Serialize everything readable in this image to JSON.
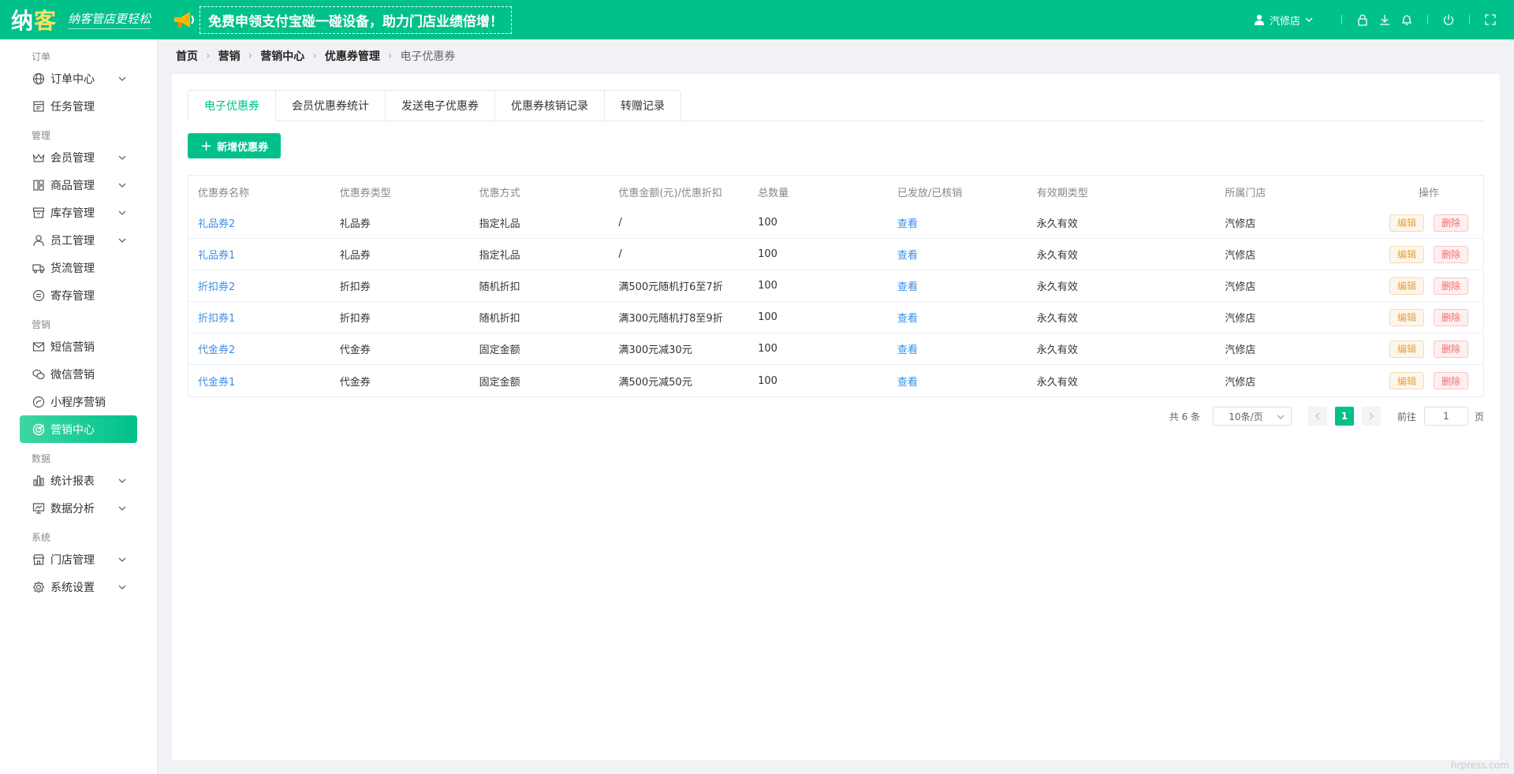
{
  "header": {
    "logo_part1": "纳",
    "logo_part2": "客",
    "slogan": "纳客管店更轻松",
    "promo": "免费申领支付宝碰一碰设备，助力门店业绩倍增！",
    "store_name": "汽修店"
  },
  "sidebar": {
    "groups": {
      "order": "订单",
      "manage": "管理",
      "marketing": "营销",
      "data": "数据",
      "system": "系统"
    },
    "items": {
      "order_center": "订单中心",
      "task_manage": "任务管理",
      "member_manage": "会员管理",
      "goods_manage": "商品管理",
      "stock_manage": "库存管理",
      "staff_manage": "员工管理",
      "logistics_manage": "货流管理",
      "deposit_manage": "寄存管理",
      "sms_marketing": "短信营销",
      "wechat_marketing": "微信营销",
      "miniapp_marketing": "小程序营销",
      "marketing_center": "营销中心",
      "stat_report": "统计报表",
      "data_analysis": "数据分析",
      "store_manage": "门店管理",
      "system_settings": "系统设置"
    }
  },
  "breadcrumb": [
    "首页",
    "营销",
    "营销中心",
    "优惠券管理",
    "电子优惠券"
  ],
  "tabs": [
    "电子优惠券",
    "会员优惠券统计",
    "发送电子优惠券",
    "优惠券核销记录",
    "转赠记录"
  ],
  "add_button": "新增优惠券",
  "table": {
    "headers": [
      "优惠券名称",
      "优惠券类型",
      "优惠方式",
      "优惠金额(元)/优惠折扣",
      "总数量",
      "已发放/已核销",
      "有效期类型",
      "所属门店",
      "操作"
    ],
    "rows": [
      [
        "礼品券2",
        "礼品券",
        "指定礼品",
        "/",
        "100",
        "查看",
        "永久有效",
        "汽修店"
      ],
      [
        "礼品券1",
        "礼品券",
        "指定礼品",
        "/",
        "100",
        "查看",
        "永久有效",
        "汽修店"
      ],
      [
        "折扣券2",
        "折扣券",
        "随机折扣",
        "满500元随机打6至7折",
        "100",
        "查看",
        "永久有效",
        "汽修店"
      ],
      [
        "折扣券1",
        "折扣券",
        "随机折扣",
        "满300元随机打8至9折",
        "100",
        "查看",
        "永久有效",
        "汽修店"
      ],
      [
        "代金券2",
        "代金券",
        "固定金额",
        "满300元减30元",
        "100",
        "查看",
        "永久有效",
        "汽修店"
      ],
      [
        "代金券1",
        "代金券",
        "固定金额",
        "满500元减50元",
        "100",
        "查看",
        "永久有效",
        "汽修店"
      ]
    ],
    "edit_label": "编辑",
    "delete_label": "删除"
  },
  "pagination": {
    "total": "共 6 条",
    "page_size": "10条/页",
    "current_page": "1",
    "goto_label": "前往",
    "goto_value": "1",
    "page_suffix": "页"
  },
  "watermark": "hrpress.com",
  "colors": {
    "primary": "#00c18a",
    "link": "#3a8ee6",
    "edit": "#e6a23c",
    "delete": "#f56c6c"
  }
}
